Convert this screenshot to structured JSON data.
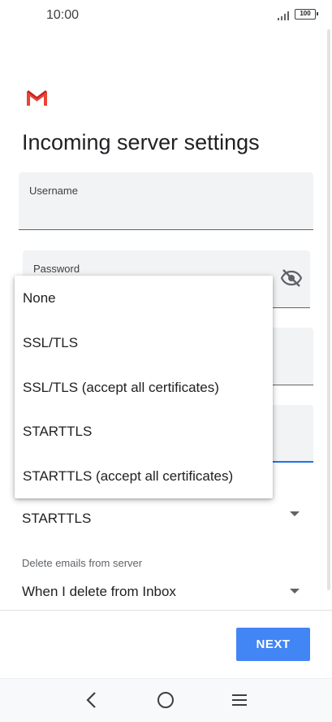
{
  "status_bar": {
    "time": "10:00",
    "battery": "100"
  },
  "page": {
    "title": "Incoming server settings"
  },
  "fields": {
    "username_label": "Username",
    "password_label": "Password"
  },
  "security": {
    "value": "STARTTLS"
  },
  "delete_emails": {
    "label": "Delete emails from server",
    "value": "When I delete from Inbox"
  },
  "footer": {
    "next_label": "NEXT"
  },
  "dropdown": {
    "items": [
      {
        "label": "None"
      },
      {
        "label": "SSL/TLS"
      },
      {
        "label": "SSL/TLS (accept all certificates)"
      },
      {
        "label": "STARTTLS"
      },
      {
        "label": "STARTTLS (accept all certificates)"
      }
    ]
  },
  "colors": {
    "accent": "#4285f4",
    "focus_underline": "#1a73e8",
    "gmail_red": "#ea4335"
  }
}
